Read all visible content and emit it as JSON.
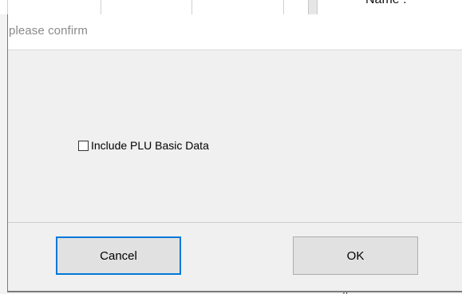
{
  "background": {
    "name_label": "Name :",
    "bottom_text": "o"
  },
  "dialog": {
    "title": "please confirm",
    "checkbox": {
      "label": "Include PLU Basic Data",
      "checked": false
    },
    "buttons": {
      "cancel_label": "Cancel",
      "ok_label": "OK"
    }
  },
  "colors": {
    "dialog_bg": "#f0f0f0",
    "title_text": "#8a8a8a",
    "focus_border": "#0078d7",
    "button_bg": "#e1e1e1"
  }
}
